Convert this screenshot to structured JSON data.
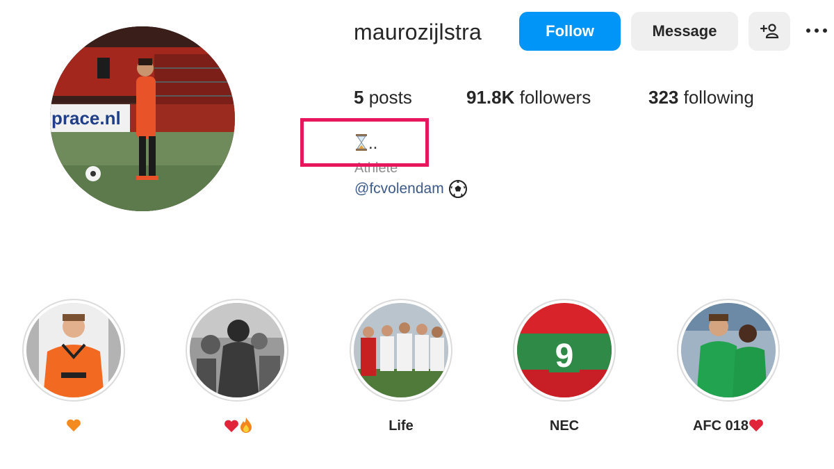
{
  "profile": {
    "username": "maurozijlstra",
    "follow_label": "Follow",
    "message_label": "Message",
    "stats": {
      "posts_count": "5",
      "posts_label": "posts",
      "followers_count": "91.8K",
      "followers_label": "followers",
      "following_count": "323",
      "following_label": "following"
    },
    "bio": {
      "emoji_text": "..",
      "category": "Athlete",
      "tag": "@fcvolendam"
    },
    "avatar_banner_text": "prace.nl"
  },
  "highlights": [
    {
      "label": "",
      "emoji": "orange-heart",
      "image": "player-orange-kit"
    },
    {
      "label": "",
      "emoji": "red-heart-fire",
      "image": "bw-crowd"
    },
    {
      "label": "Life",
      "emoji": "",
      "image": "team-celebration"
    },
    {
      "label": "NEC",
      "emoji": "",
      "image": "jersey-9"
    },
    {
      "label": "AFC 018",
      "emoji": "red-heart",
      "image": "two-players-green"
    }
  ],
  "highlight_number": "9",
  "colors": {
    "follow_bg": "#0095f6",
    "secondary_btn_bg": "#efefef",
    "annotation_box": "#e8175d",
    "link": "#3c5a89"
  }
}
